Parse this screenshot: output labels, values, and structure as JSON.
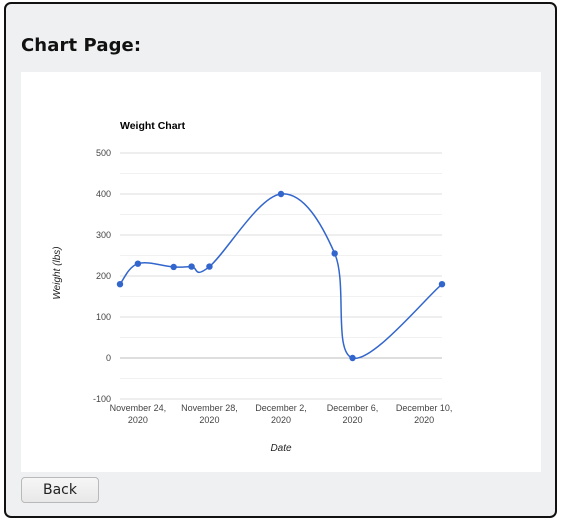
{
  "page": {
    "title": "Chart Page:"
  },
  "chart_data": {
    "type": "line",
    "title": "Weight Chart",
    "xlabel": "Date",
    "ylabel": "Weight (lbs)",
    "x_type": "date",
    "x_range": [
      "2020-11-23",
      "2020-12-11"
    ],
    "ylim": [
      -100,
      500
    ],
    "y_ticks": [
      -100,
      0,
      100,
      200,
      300,
      400,
      500
    ],
    "x_ticks": [
      {
        "date": "2020-11-24",
        "label_line1": "November 24,",
        "label_line2": "2020"
      },
      {
        "date": "2020-11-28",
        "label_line1": "November 28,",
        "label_line2": "2020"
      },
      {
        "date": "2020-12-02",
        "label_line1": "December 2,",
        "label_line2": "2020"
      },
      {
        "date": "2020-12-06",
        "label_line1": "December 6,",
        "label_line2": "2020"
      },
      {
        "date": "2020-12-10",
        "label_line1": "December 10,",
        "label_line2": "2020"
      }
    ],
    "gridlines": true,
    "minor_gridlines": true,
    "line_color": "#3366cc",
    "smooth": true,
    "series": [
      {
        "points": [
          {
            "x": "2020-11-23",
            "y": 180
          },
          {
            "x": "2020-11-24",
            "y": 230
          },
          {
            "x": "2020-11-26",
            "y": 222
          },
          {
            "x": "2020-11-27",
            "y": 223
          },
          {
            "x": "2020-11-28",
            "y": 223
          },
          {
            "x": "2020-12-02",
            "y": 400
          },
          {
            "x": "2020-12-05",
            "y": 255
          },
          {
            "x": "2020-12-06",
            "y": 0
          },
          {
            "x": "2020-12-11",
            "y": 180
          }
        ]
      }
    ]
  },
  "actions": {
    "back_label": "Back"
  }
}
